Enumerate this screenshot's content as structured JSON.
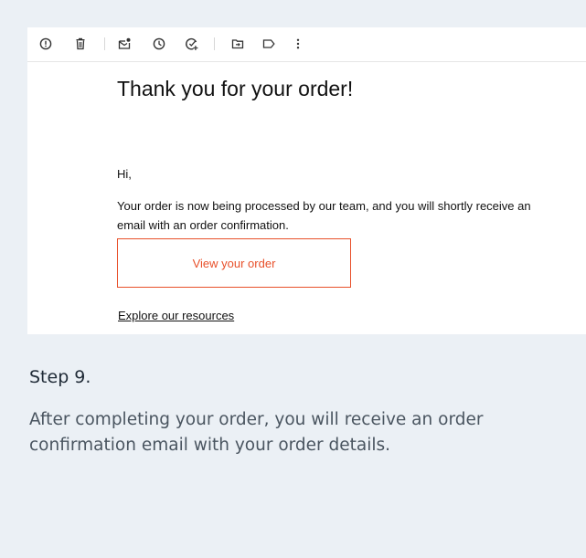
{
  "toolbar": {
    "icons": [
      {
        "name": "report-spam-icon"
      },
      {
        "name": "delete-icon"
      },
      {
        "name": "mark-unread-icon"
      },
      {
        "name": "snooze-icon"
      },
      {
        "name": "add-to-tasks-icon"
      },
      {
        "name": "move-to-icon"
      },
      {
        "name": "label-icon"
      },
      {
        "name": "more-options-icon"
      }
    ]
  },
  "email": {
    "title": "Thank you for your order!",
    "greeting": "Hi,",
    "body": "Your order is now being processed by our team, and you will shortly receive an email with an order confirmation.",
    "button_label": "View your order",
    "link_label": "Explore our resources"
  },
  "colors": {
    "accent": "#e8502a",
    "background": "#ebf0f5"
  },
  "step": {
    "heading": "Step 9.",
    "description": "After completing your order, you will receive an order confirmation email with your order details."
  }
}
